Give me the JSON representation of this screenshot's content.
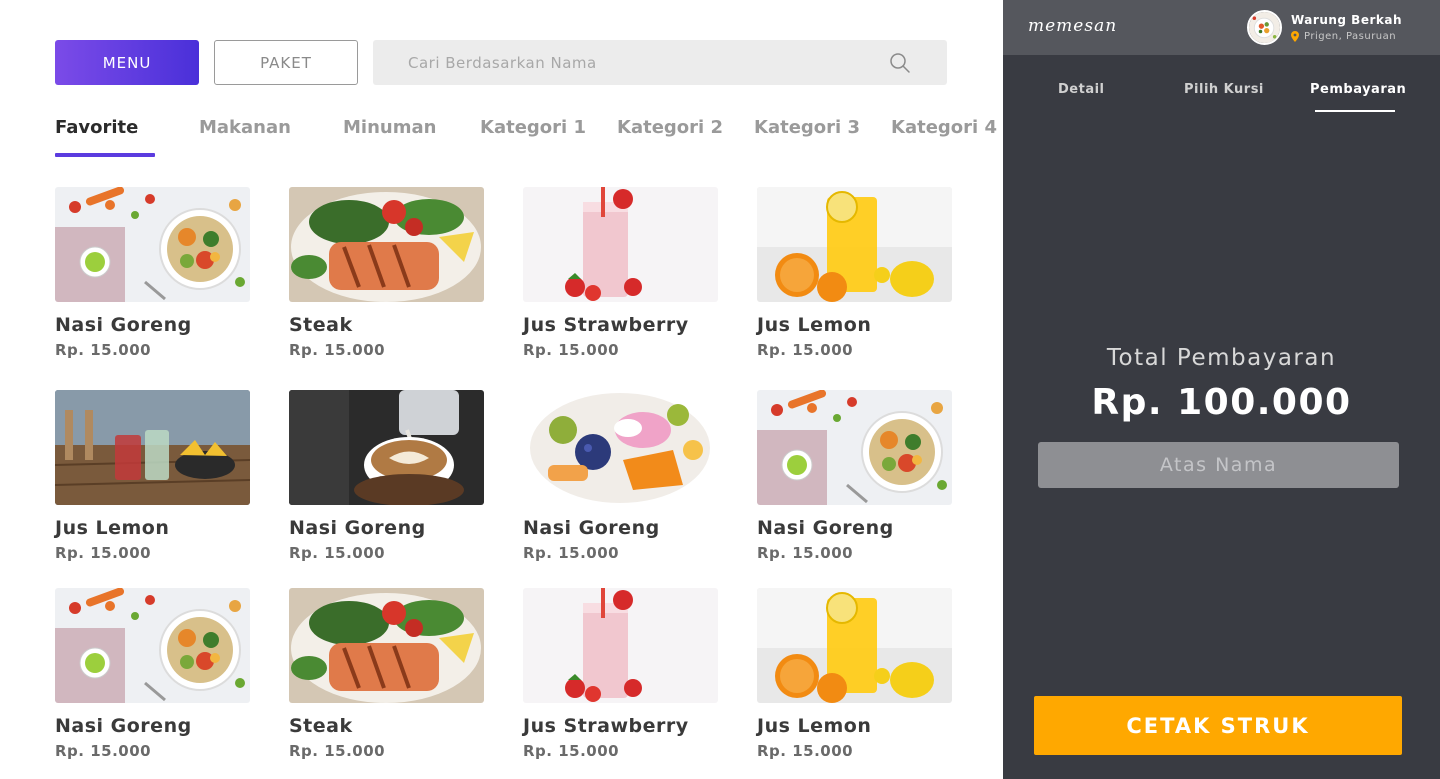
{
  "toolbar": {
    "menu_label": "MENU",
    "paket_label": "PAKET",
    "search_placeholder": "Cari Berdasarkan Nama"
  },
  "categories": [
    "Favorite",
    "Makanan",
    "Minuman",
    "Kategori 1",
    "Kategori 2",
    "Kategori 3",
    "Kategori 4"
  ],
  "active_category": "Favorite",
  "items": [
    {
      "name": "Nasi Goreng",
      "price": "Rp. 15.000",
      "image": "salad-bowl"
    },
    {
      "name": "Steak",
      "price": "Rp. 15.000",
      "image": "salmon-steak"
    },
    {
      "name": "Jus Strawberry",
      "price": "Rp. 15.000",
      "image": "strawberry-juice"
    },
    {
      "name": "Jus Lemon",
      "price": "Rp. 15.000",
      "image": "orange-juice"
    },
    {
      "name": "Jus Lemon",
      "price": "Rp. 15.000",
      "image": "cafe-drinks"
    },
    {
      "name": "Nasi Goreng",
      "price": "Rp. 15.000",
      "image": "latte-art"
    },
    {
      "name": "Nasi Goreng",
      "price": "Rp. 15.000",
      "image": "fruit-platter"
    },
    {
      "name": "Nasi Goreng",
      "price": "Rp. 15.000",
      "image": "salad-bowl"
    },
    {
      "name": "Nasi Goreng",
      "price": "Rp. 15.000",
      "image": "salad-bowl"
    },
    {
      "name": "Steak",
      "price": "Rp. 15.000",
      "image": "salmon-steak"
    },
    {
      "name": "Jus Strawberry",
      "price": "Rp. 15.000",
      "image": "strawberry-juice"
    },
    {
      "name": "Jus Lemon",
      "price": "Rp. 15.000",
      "image": "orange-juice"
    }
  ],
  "panel": {
    "brand": "memesan",
    "store_name": "Warung Berkah",
    "store_location": "Prigen, Pasuruan",
    "tabs": [
      "Detail",
      "Pilih Kursi",
      "Pembayaran"
    ],
    "active_tab": "Pembayaran",
    "total_label": "Total Pembayaran",
    "total_amount": "Rp. 100.000",
    "name_placeholder": "Atas Nama",
    "print_label": "CETAK STRUK"
  },
  "colors": {
    "accent_purple": "#5b3bdf",
    "panel_bg": "#393b42",
    "panel_header": "#55575d",
    "print_button": "#ffa800"
  }
}
